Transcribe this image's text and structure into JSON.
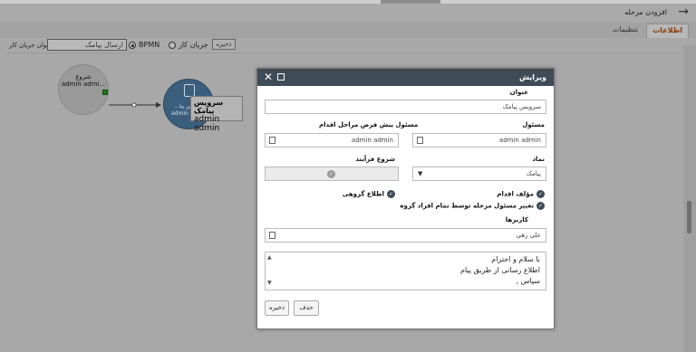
{
  "header": {
    "title": "افزودن مرحله",
    "back_icon": "arrow-right-icon"
  },
  "tabs": [
    {
      "label": "اطلاعات",
      "active": true
    },
    {
      "label": "تنظیمات",
      "active": false
    }
  ],
  "toolbar": {
    "flow_title_label": "عنوان جریان کار",
    "flow_title_value": "ارسال پیامک",
    "option_bpmn": "BPMN",
    "option_workflow": "جریان کار",
    "selected": "BPMN",
    "save_label": "ذخیره"
  },
  "canvas": {
    "start_node": {
      "title": "شروع",
      "subtitle": "admin admi..."
    },
    "sms_node": {
      "title": "سرویس پیا...",
      "subtitle": "admin ad..."
    },
    "tooltip": {
      "title": "سرویس پیامک",
      "subtitle": "admin admin"
    }
  },
  "dialog": {
    "title": "ویرایش",
    "subject_label": "عنوان",
    "subject_value": "سرویس پیامک",
    "responsible_label": "مسئول",
    "responsible_value": "admin admin",
    "default_responsible_label": "مسئول پیش فرض مراحل اقدام",
    "default_responsible_value": "admin admin",
    "symbol_label": "نماد",
    "symbol_value": "پیامک",
    "process_start_label": "شروع فرآیند",
    "action_author_label": "مؤلف اقدام",
    "group_notify_label": "اطلاع گروهی",
    "change_responsible_label": "تغییر مسئول مرحله توسط تمام افراد گروه",
    "users_label": "کاربرها",
    "users_value": "علی رهی",
    "message_lines": [
      "با سلام و احترام",
      "اطلاع رسانی از طریق پیام",
      "سپاس ,"
    ],
    "delete_label": "حذف",
    "save_label": "ذخیره"
  },
  "colors": {
    "dialog_header": "#3f4b57",
    "active_tab": "#8a3d0a",
    "start_connector": "#1f7a1f",
    "sms_node": "#3a5e7c"
  }
}
